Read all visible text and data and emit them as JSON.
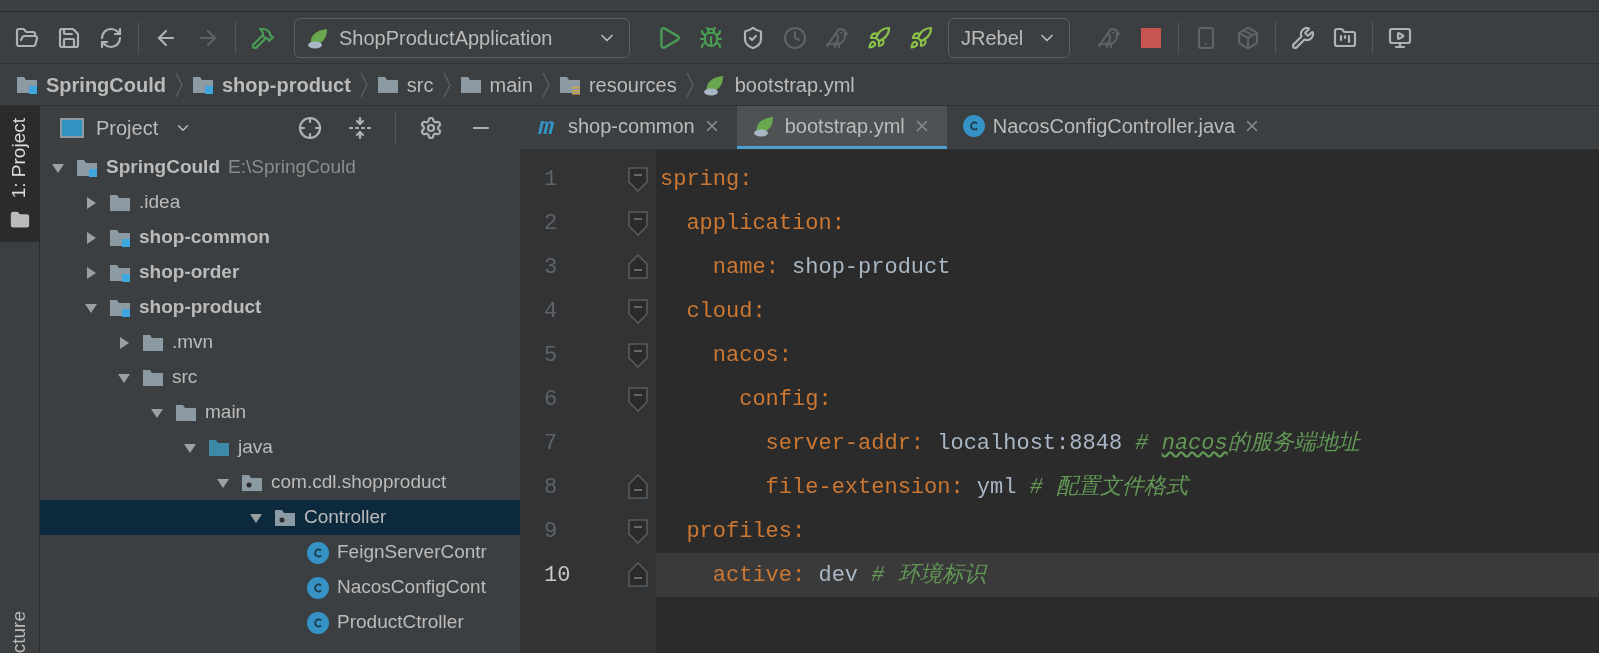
{
  "toolbar": {
    "run_config": "ShopProductApplication",
    "rebel_config": "JRebel"
  },
  "breadcrumbs": [
    {
      "label": "SpringCould",
      "kind": "module",
      "bold": true
    },
    {
      "label": "shop-product",
      "kind": "module",
      "bold": true
    },
    {
      "label": "src",
      "kind": "folder",
      "bold": false
    },
    {
      "label": "main",
      "kind": "folder",
      "bold": false
    },
    {
      "label": "resources",
      "kind": "resources",
      "bold": false
    },
    {
      "label": "bootstrap.yml",
      "kind": "yml",
      "bold": false
    }
  ],
  "tool_stripe": {
    "top": {
      "label": "1: Project",
      "selected": true
    },
    "bottom": {
      "label": "cture",
      "selected": false
    }
  },
  "project_panel": {
    "title": "Project",
    "tree": [
      {
        "label": "SpringCould",
        "secondary": "E:\\SpringCould",
        "kind": "module",
        "bold": true,
        "expanded": true,
        "selected": false,
        "children": [
          {
            "label": ".idea",
            "kind": "folder",
            "bold": false,
            "expanded": false,
            "selected": false
          },
          {
            "label": "shop-common",
            "kind": "module",
            "bold": true,
            "expanded": false,
            "selected": false
          },
          {
            "label": "shop-order",
            "kind": "module",
            "bold": true,
            "expanded": false,
            "selected": false
          },
          {
            "label": "shop-product",
            "kind": "module",
            "bold": true,
            "expanded": true,
            "selected": false,
            "children": [
              {
                "label": ".mvn",
                "kind": "folder",
                "bold": false,
                "expanded": false,
                "selected": false
              },
              {
                "label": "src",
                "kind": "folder",
                "bold": false,
                "expanded": true,
                "selected": false,
                "children": [
                  {
                    "label": "main",
                    "kind": "folder",
                    "bold": false,
                    "expanded": true,
                    "selected": false,
                    "children": [
                      {
                        "label": "java",
                        "kind": "source",
                        "bold": false,
                        "expanded": true,
                        "selected": false,
                        "children": [
                          {
                            "label": "com.cdl.shopproduct",
                            "kind": "package",
                            "bold": false,
                            "expanded": true,
                            "selected": false,
                            "children": [
                              {
                                "label": "Controller",
                                "kind": "package",
                                "bold": false,
                                "expanded": true,
                                "selected": true,
                                "children": [
                                  {
                                    "label": "FeignServerContr",
                                    "kind": "class",
                                    "bold": false,
                                    "selected": false
                                  },
                                  {
                                    "label": "NacosConfigCont",
                                    "kind": "class",
                                    "bold": false,
                                    "selected": false
                                  },
                                  {
                                    "label": "ProductCtroller",
                                    "kind": "class",
                                    "bold": false,
                                    "selected": false
                                  }
                                ]
                              }
                            ]
                          }
                        ]
                      }
                    ]
                  }
                ]
              }
            ]
          }
        ]
      }
    ]
  },
  "editor_tabs": [
    {
      "label": "shop-common",
      "kind": "maven",
      "selected": false
    },
    {
      "label": "bootstrap.yml",
      "kind": "yml",
      "selected": true
    },
    {
      "label": "NacosConfigController.java",
      "kind": "class",
      "selected": false
    }
  ],
  "editor_lines": [
    {
      "number": "1",
      "kind": "fold_start",
      "current": false,
      "tokens": [
        {
          "kind": "key",
          "text": "spring"
        },
        {
          "kind": "punct",
          "text": ":"
        }
      ]
    },
    {
      "number": "2",
      "kind": "fold_start",
      "current": false,
      "tokens": [
        {
          "kind": "key",
          "text": "  application"
        },
        {
          "kind": "punct",
          "text": ":"
        }
      ]
    },
    {
      "number": "3",
      "kind": "fold_end",
      "current": false,
      "tokens": [
        {
          "kind": "key",
          "text": "    name"
        },
        {
          "kind": "punct",
          "text": ": "
        },
        {
          "kind": "value",
          "text": "shop-product"
        }
      ]
    },
    {
      "number": "4",
      "kind": "fold_start",
      "current": false,
      "tokens": [
        {
          "kind": "key",
          "text": "  cloud"
        },
        {
          "kind": "punct",
          "text": ":"
        }
      ]
    },
    {
      "number": "5",
      "kind": "fold_start",
      "current": false,
      "tokens": [
        {
          "kind": "key",
          "text": "    nacos"
        },
        {
          "kind": "punct",
          "text": ":"
        }
      ]
    },
    {
      "number": "6",
      "kind": "fold_start",
      "current": false,
      "tokens": [
        {
          "kind": "key",
          "text": "      config"
        },
        {
          "kind": "punct",
          "text": ":"
        }
      ]
    },
    {
      "number": "7",
      "kind": "plain",
      "current": false,
      "tokens": [
        {
          "kind": "key",
          "text": "        server-addr"
        },
        {
          "kind": "punct",
          "text": ": "
        },
        {
          "kind": "value",
          "text": "localhost:8848 "
        },
        {
          "kind": "comment",
          "text": "# "
        },
        {
          "kind": "typo",
          "text": "nacos"
        },
        {
          "kind": "comment",
          "text": "的服务端地址"
        }
      ]
    },
    {
      "number": "8",
      "kind": "fold_end",
      "current": false,
      "tokens": [
        {
          "kind": "key",
          "text": "        file-extension"
        },
        {
          "kind": "punct",
          "text": ": "
        },
        {
          "kind": "value",
          "text": "yml "
        },
        {
          "kind": "comment",
          "text": "# 配置文件格式"
        }
      ]
    },
    {
      "number": "9",
      "kind": "fold_start",
      "current": false,
      "tokens": [
        {
          "kind": "key",
          "text": "  profiles"
        },
        {
          "kind": "punct",
          "text": ":"
        }
      ]
    },
    {
      "number": "10",
      "kind": "fold_end",
      "current": true,
      "tokens": [
        {
          "kind": "key",
          "text": "    active"
        },
        {
          "kind": "punct",
          "text": ": "
        },
        {
          "kind": "value",
          "text": "dev "
        },
        {
          "kind": "comment",
          "text": "# 环境标识"
        }
      ]
    }
  ]
}
